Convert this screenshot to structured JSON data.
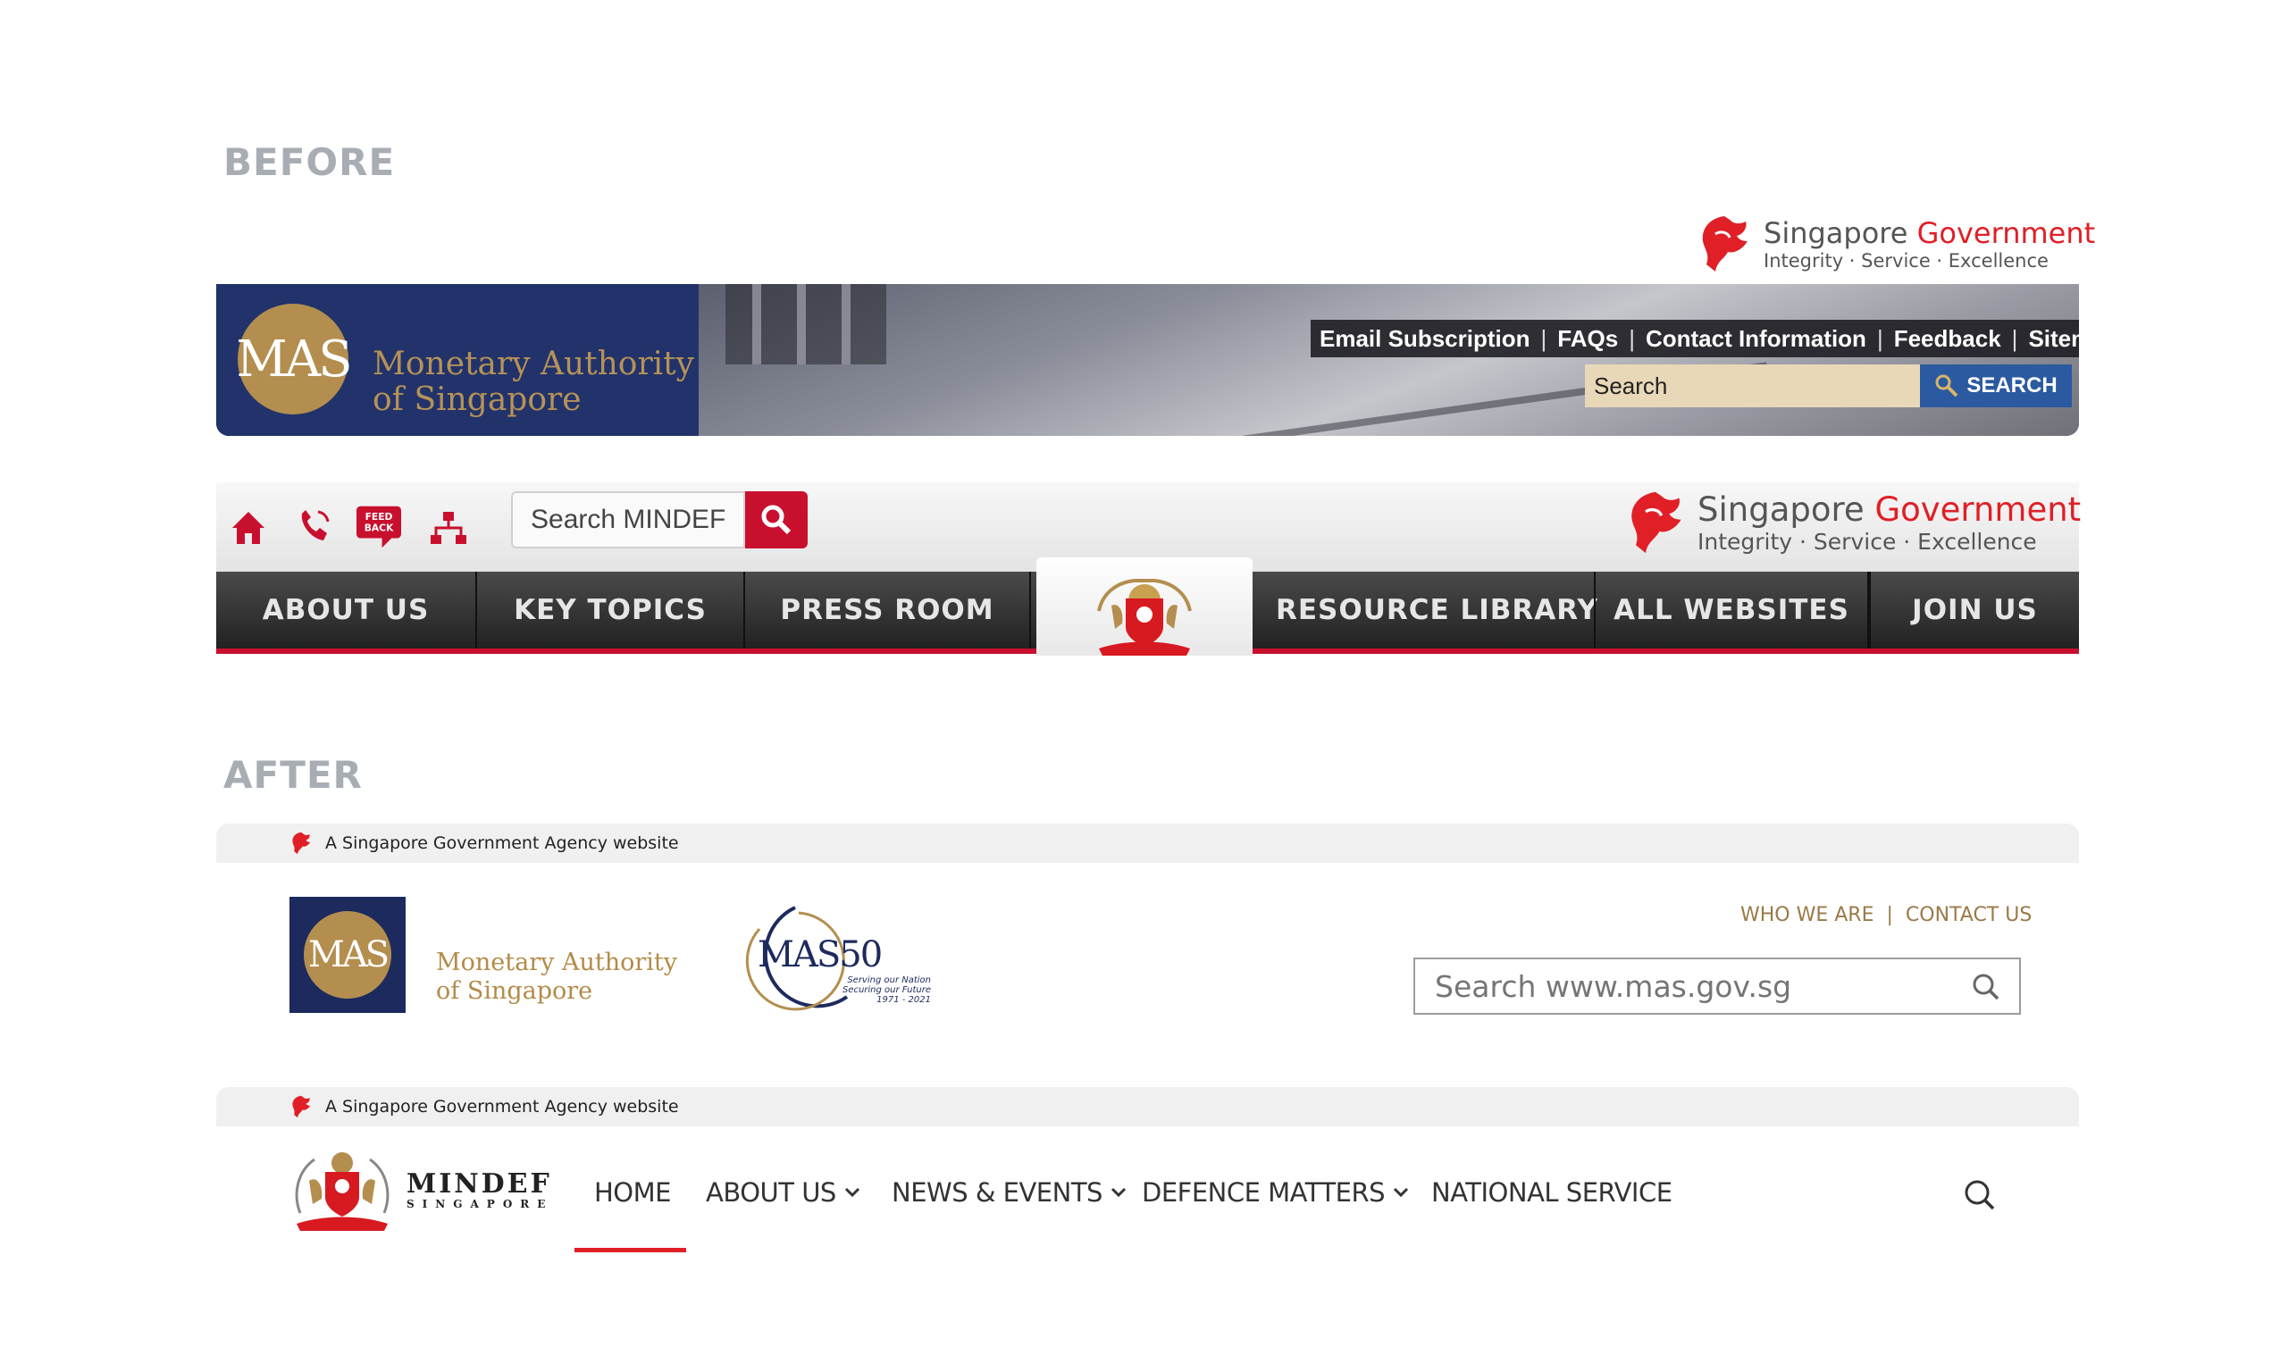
{
  "labels": {
    "before": "BEFORE",
    "after": "AFTER"
  },
  "sg_gov": {
    "word1": "Singapore",
    "word2": "Government",
    "tagline": "Integrity  ·  Service  ·  Excellence"
  },
  "mas_old": {
    "seal": "MAS",
    "name_line1": "Monetary Authority",
    "name_line2": "of Singapore",
    "links": [
      "Email Subscription",
      "FAQs",
      "Contact Information",
      "Feedback",
      "Sitemap"
    ],
    "search_value": "Search",
    "search_button": "SEARCH"
  },
  "mindef_old": {
    "icons": [
      "home-icon",
      "phone-icon",
      "feedback-icon",
      "sitemap-icon"
    ],
    "feedback_text": "FEED BACK",
    "search_value": "Search MINDEF",
    "nav": [
      "ABOUT US",
      "KEY TOPICS",
      "PRESS ROOM",
      "RESOURCE LIBRARY",
      "ALL WEBSITES",
      "JOIN US"
    ]
  },
  "masthead": {
    "text": "A Singapore Government Agency website"
  },
  "mas_new": {
    "seal": "MAS",
    "name_line1": "Monetary Authority",
    "name_line2": "of Singapore",
    "anniv_title": "MAS50",
    "anniv_line1": "Serving our Nation",
    "anniv_line2": "Securing our Future",
    "anniv_years": "1971 - 2021",
    "links": [
      "WHO WE ARE",
      "CONTACT US"
    ],
    "search_placeholder": "Search www.mas.gov.sg"
  },
  "mindef_new": {
    "word1": "MINDEF",
    "word2": "SINGAPORE",
    "nav": [
      "HOME",
      "ABOUT US",
      "NEWS & EVENTS",
      "DEFENCE MATTERS",
      "NATIONAL SERVICE"
    ],
    "active": "HOME"
  },
  "colors": {
    "accent_red": "#e01f26",
    "mas_navy": "#22336b",
    "mas_gold": "#b48e4f",
    "label_grey": "#a8adb4"
  }
}
